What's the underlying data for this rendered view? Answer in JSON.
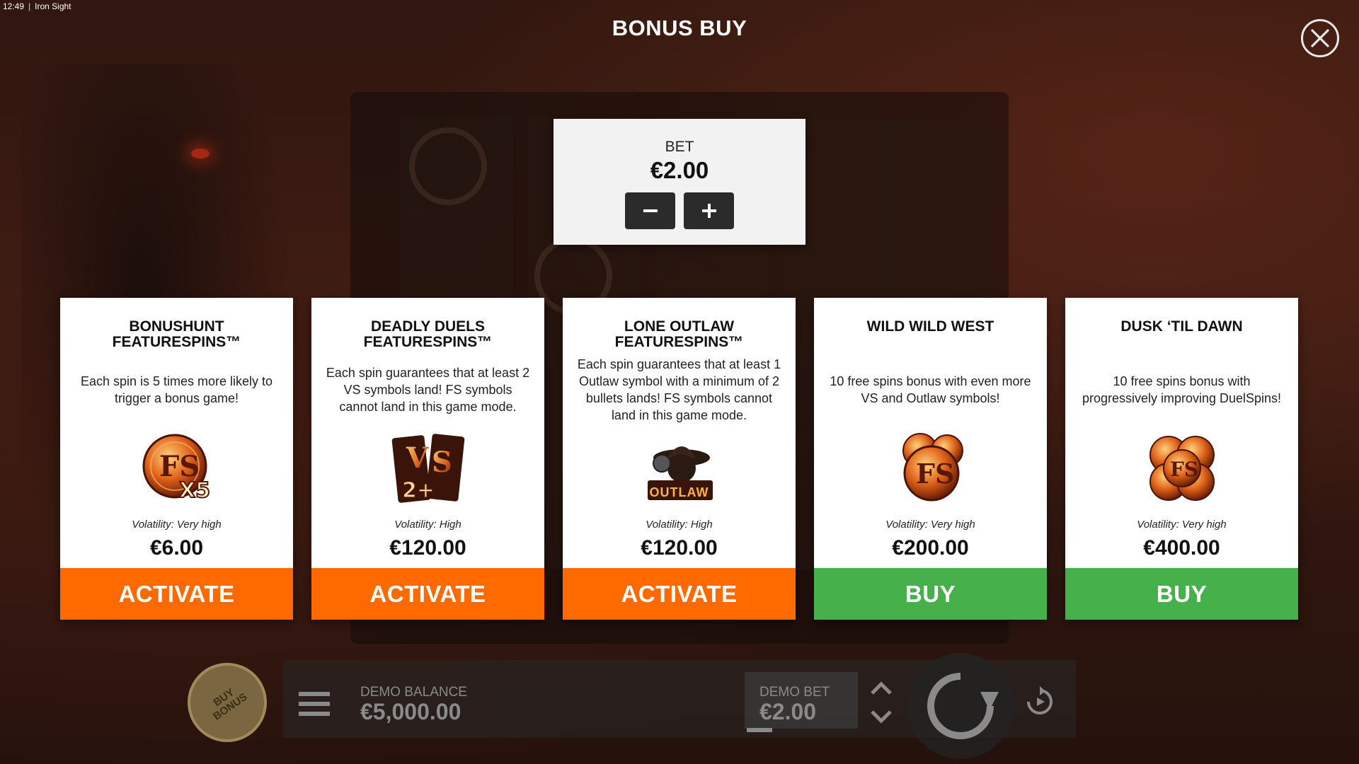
{
  "status_bar": {
    "time": "12:49",
    "separator": "|",
    "app_name": "Iron Sight"
  },
  "header": {
    "title": "BONUS BUY",
    "close_icon": "close-icon"
  },
  "bet_panel": {
    "label": "BET",
    "value": "€2.00",
    "decrease_icon": "minus-icon",
    "increase_icon": "plus-icon"
  },
  "cards": [
    {
      "title_line1": "BONUSHUNT",
      "title_line2": "FEATURESPINS™",
      "description": "Each spin is 5 times more likely to trigger a bonus game!",
      "icon": "fs-x5-icon",
      "volatility": "Volatility: Very high",
      "price": "€6.00",
      "button": "ACTIVATE"
    },
    {
      "title_line1": "DEADLY DUELS",
      "title_line2": "FEATURESPINS™",
      "description": "Each spin guarantees that at least 2 VS symbols land! FS symbols cannot land in this game mode.",
      "icon": "vs-2plus-icon",
      "volatility": "Volatility: High",
      "price": "€120.00",
      "button": "ACTIVATE"
    },
    {
      "title_line1": "LONE OUTLAW",
      "title_line2": "FEATURESPINS™",
      "description": "Each spin guarantees that at least 1 Outlaw symbol with a minimum of 2 bullets lands! FS symbols cannot land in this game mode.",
      "icon": "outlaw-icon",
      "icon_text": "OUTLAW",
      "volatility": "Volatility: High",
      "price": "€120.00",
      "button": "ACTIVATE"
    },
    {
      "title_line1": "WILD WILD WEST",
      "title_line2": "",
      "description": "10 free spins bonus with even more VS and Outlaw symbols!",
      "icon": "fs-coins-icon",
      "volatility": "Volatility: Very high",
      "price": "€200.00",
      "button": "BUY"
    },
    {
      "title_line1": "DUSK ‘TIL DAWN",
      "title_line2": "",
      "description": "10 free spins bonus with progressively improving DuelSpins!",
      "icon": "fs-coin-stack-icon",
      "volatility": "Volatility: Very high",
      "price": "€400.00",
      "button": "BUY"
    }
  ],
  "bottom_bar": {
    "buy_bonus_line1": "BUY",
    "buy_bonus_line2": "BONUS",
    "demo_balance_label": "DEMO BALANCE",
    "demo_balance_value": "€5,000.00",
    "demo_bet_label": "DEMO BET",
    "demo_bet_value": "€2.00"
  },
  "colors": {
    "activate": "#ff6a00",
    "buy": "#46b04a",
    "card_bg": "#ffffff",
    "bet_panel_bg": "#f2f2f2",
    "bet_button_bg": "#2b2b2b"
  }
}
